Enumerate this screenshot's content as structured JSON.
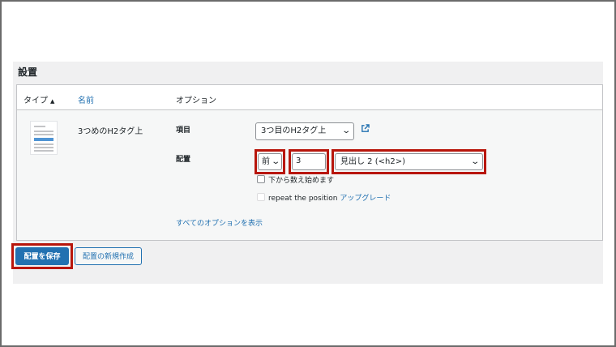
{
  "section": {
    "title": "設置"
  },
  "table": {
    "headers": {
      "type": "タイプ",
      "name": "名前",
      "options": "オプション"
    },
    "sort_icon": "▲"
  },
  "row": {
    "name": "3つめのH2タグ上",
    "item_label": "項目",
    "item_select_value": "3つ目のH2タグ上",
    "placement_label": "配置",
    "position_select_value": "前",
    "index_value": "3",
    "heading_select_value": "見出し 2 (<h2>)",
    "count_from_bottom": "下から数え始めます",
    "repeat_label": "repeat the position",
    "upgrade_link": "アップグレード",
    "show_all_options": "すべてのオプションを表示"
  },
  "buttons": {
    "save": "配置を保存",
    "new": "配置の新規作成"
  },
  "icons": {
    "sort": "sort-up-icon",
    "external": "external-link-icon",
    "chevron": "chevron-down-icon"
  },
  "colors": {
    "accent": "#2271b1",
    "highlight": "#b8160c",
    "panel": "#f0f0f1"
  }
}
